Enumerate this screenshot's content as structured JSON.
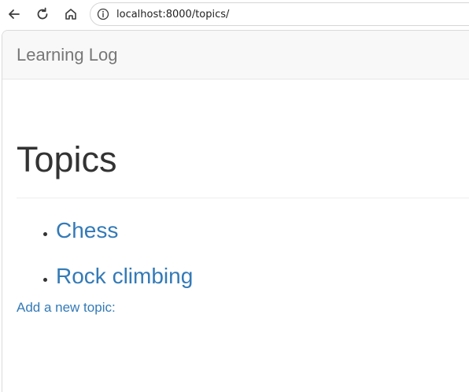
{
  "browser": {
    "url": "localhost:8000/topics/",
    "icons": {
      "back": "arrow-left-icon",
      "reload": "reload-icon",
      "home": "home-icon",
      "info": "info-icon"
    }
  },
  "navbar": {
    "brand": "Learning Log"
  },
  "page": {
    "title": "Topics",
    "topics": [
      {
        "label": "Chess"
      },
      {
        "label": "Rock climbing"
      }
    ],
    "add_link": "Add a new topic:"
  },
  "colors": {
    "link": "#337ab7",
    "brand": "#777777",
    "navbar_bg": "#f8f8f8",
    "heading": "#333333"
  }
}
